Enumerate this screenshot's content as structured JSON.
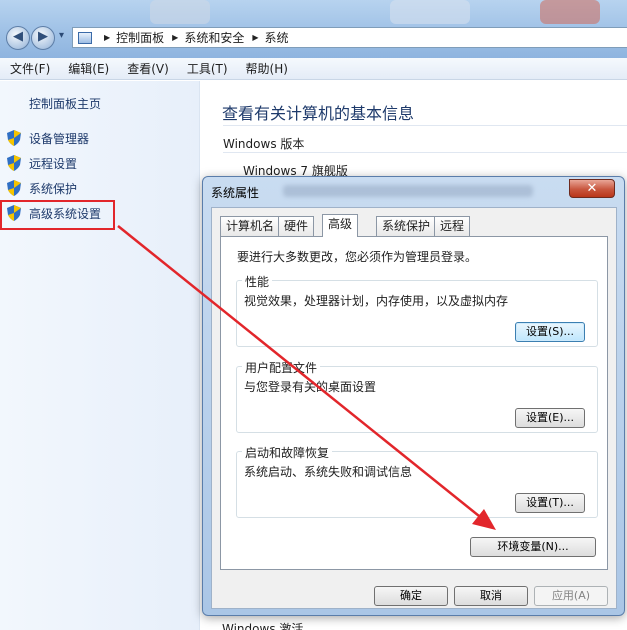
{
  "breadcrumb": [
    "控制面板",
    "系统和安全",
    "系统"
  ],
  "nav": {
    "back_glyph": "◀",
    "forward_glyph": "▶",
    "dropdown_glyph": "▾"
  },
  "menu": [
    "文件(F)",
    "编辑(E)",
    "查看(V)",
    "工具(T)",
    "帮助(H)"
  ],
  "sidebar": {
    "home": "控制面板主页",
    "tasks": [
      "设备管理器",
      "远程设置",
      "系统保护",
      "高级系统设置"
    ]
  },
  "main": {
    "title": "查看有关计算机的基本信息",
    "version_heading": "Windows 版本",
    "edition": "Windows 7 旗舰版",
    "activation_heading": "Windows 激活"
  },
  "dialog": {
    "title": "系统属性",
    "close_glyph": "✕",
    "tabs": [
      "计算机名",
      "硬件",
      "高级",
      "系统保护",
      "远程"
    ],
    "active_tab": "高级",
    "notice": "要进行大多数更改，您必须作为管理员登录。",
    "groups": [
      {
        "legend": "性能",
        "description": "视觉效果，处理器计划，内存使用，以及虚拟内存",
        "button": "设置(S)..."
      },
      {
        "legend": "用户配置文件",
        "description": "与您登录有关的桌面设置",
        "button": "设置(E)..."
      },
      {
        "legend": "启动和故障恢复",
        "description": "系统启动、系统失败和调试信息",
        "button": "设置(T)..."
      }
    ],
    "env_button": "环境变量(N)...",
    "ok": "确定",
    "cancel": "取消",
    "apply": "应用(A)"
  },
  "colors": {
    "annotation_red": "#e2262b",
    "link_blue": "#1e3a6b",
    "shield_blue": "#2f6fc4",
    "shield_yellow": "#f5c400"
  }
}
